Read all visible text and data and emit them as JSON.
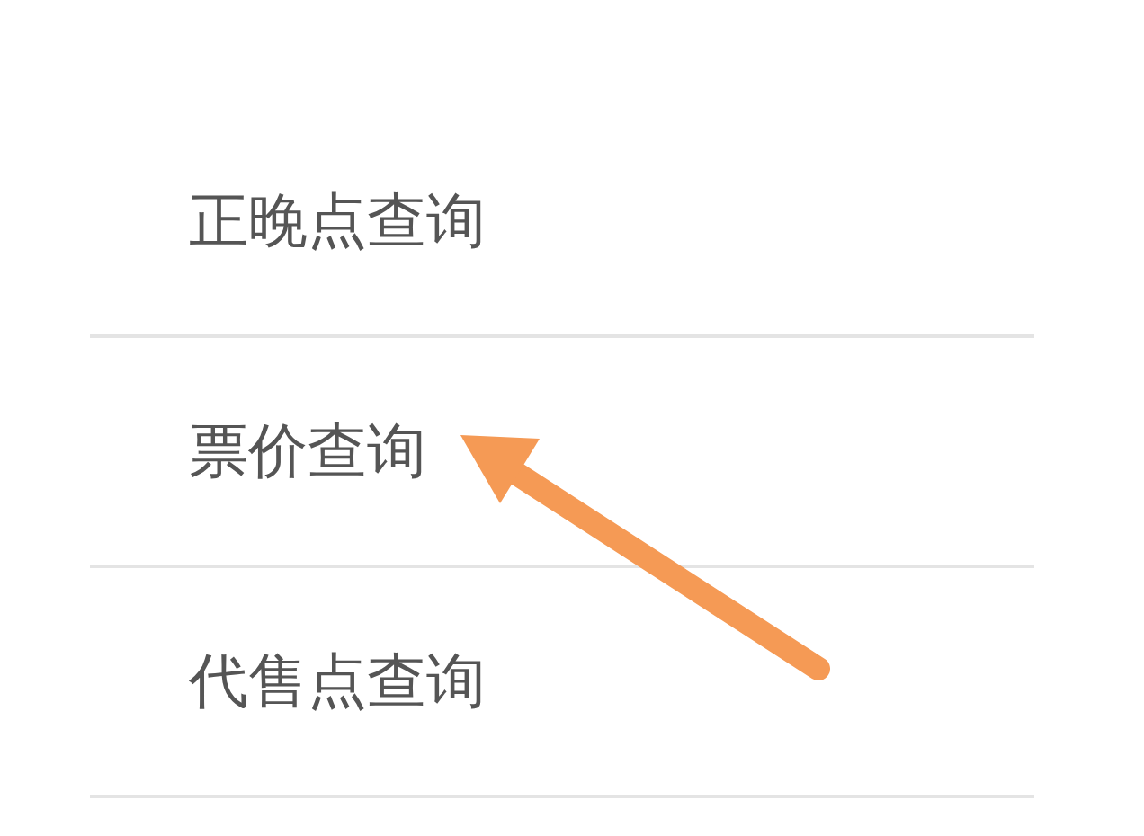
{
  "menu": {
    "items": [
      {
        "label": "正晚点查询"
      },
      {
        "label": "票价查询"
      },
      {
        "label": "代售点查询"
      }
    ]
  }
}
